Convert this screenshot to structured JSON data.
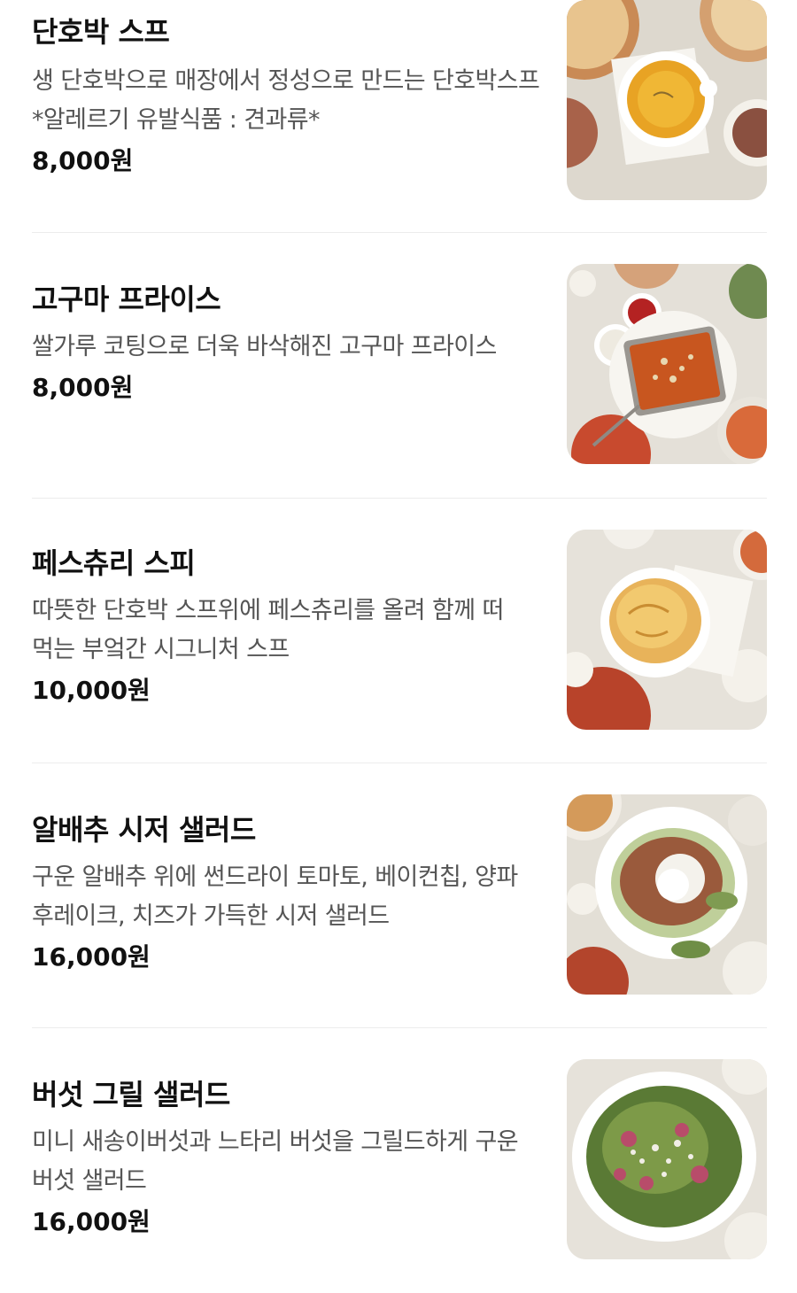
{
  "menu": {
    "items": [
      {
        "name": "단호박 스프",
        "description": "생 단호박으로 매장에서 정성으로 만드는 단호박스프 *알레르기 유발식품 : 견과류*",
        "price": "8,000원",
        "image_alt": "단호박 스프"
      },
      {
        "name": "고구마 프라이스",
        "description": "쌀가루 코팅으로 더욱 바삭해진 고구마 프라이스",
        "price": "8,000원",
        "image_alt": "고구마 프라이스"
      },
      {
        "name": "페스츄리 스피",
        "description": "따뜻한 단호박 스프위에 페스츄리를 올려 함께 떠 먹는 부엌간 시그니처 스프",
        "price": "10,000원",
        "image_alt": "페스츄리 스피"
      },
      {
        "name": "알배추 시저 샐러드",
        "description": "구운 알배추 위에 썬드라이 토마토, 베이컨칩, 양파 후레이크, 치즈가 가득한 시저 샐러드",
        "price": "16,000원",
        "image_alt": "알배추 시저 샐러드"
      },
      {
        "name": "버섯 그릴 샐러드",
        "description": "미니 새송이버섯과 느타리 버섯을 그릴드하게 구운 버섯 샐러드",
        "price": "16,000원",
        "image_alt": "버섯 그릴 샐러드"
      }
    ]
  }
}
